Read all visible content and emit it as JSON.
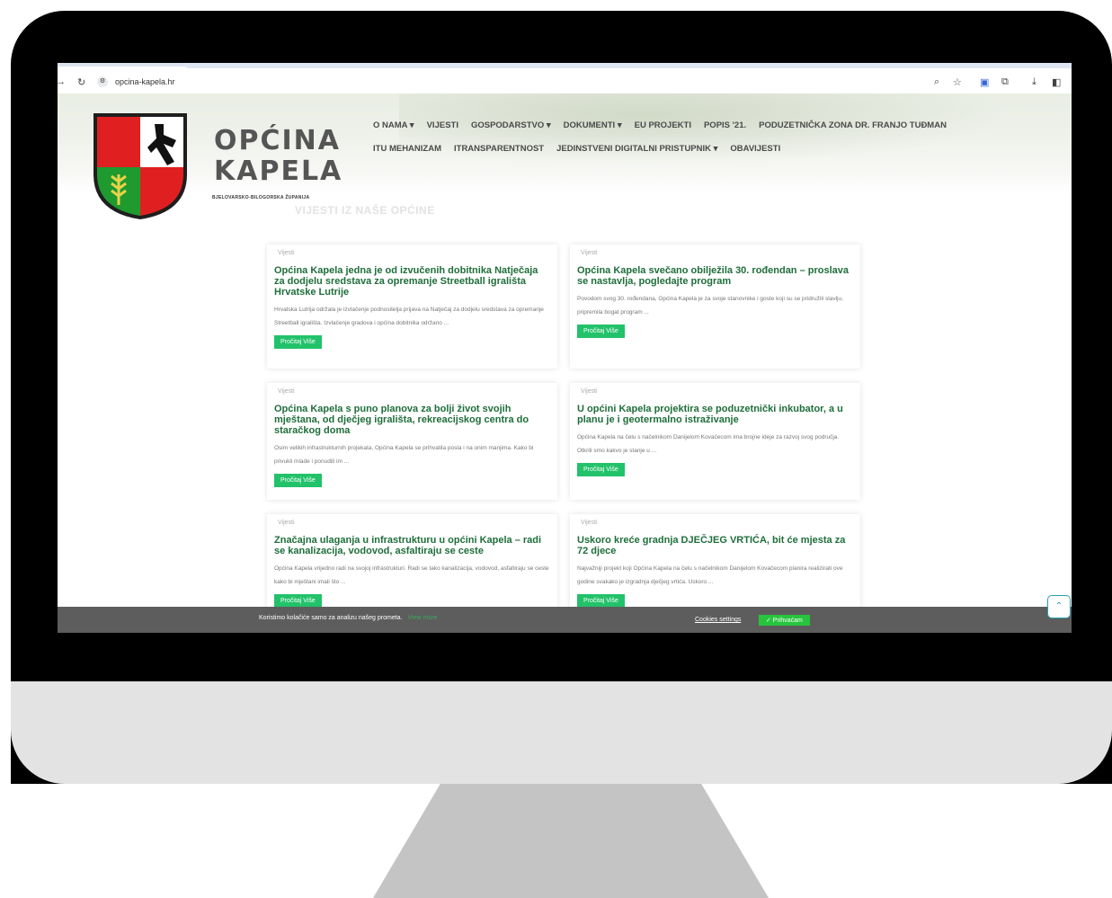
{
  "browser": {
    "url": "opcina-kapela.hr",
    "icons": {
      "back": "arrow-back-icon",
      "reload": "reload-icon",
      "tune": "site-info-icon",
      "zoom": "zoom-icon",
      "star": "bookmark-star-icon",
      "translate": "translate-icon",
      "extensions": "extensions-icon",
      "download": "download-icon",
      "sidepanel": "side-panel-icon"
    }
  },
  "logo": {
    "line1": "OPĆINA",
    "line2": "KAPELA",
    "subtitle": "BJELOVARSKO-BILOGORSKA ŽUPANIJA"
  },
  "menu": {
    "row1": [
      "O NAMA ▾",
      "VIJESTI",
      "GOSPODARSTVO ▾",
      "DOKUMENTI ▾",
      "EU PROJEKTI",
      "POPIS '21.",
      "PODUZETNIČKA ZONA DR. FRANJO TUĐMAN"
    ],
    "row2": [
      "ITU MEHANIZAM",
      "ITRANSPARENTNOST",
      "JEDINSTVENI DIGITALNI PRISTUPNIK ▾",
      "OBAVIJESTI"
    ]
  },
  "section_title": "VIJESTI IZ NAŠE OPĆINE",
  "cards": [
    {
      "category": "Vijesti",
      "title": "Općina Kapela jedna je od izvučenih dobitnika Natječaja za dodjelu sredstava za opremanje Streetball igrališta Hrvatske Lutrije",
      "excerpt": "Hrvatska Lutrija održala je izvlačenje podnositelja prijava na Natječaj za dodjelu sredstava za opremanje Streetball igrališta. Izvlačenje gradova i općina dobitnika održano ...",
      "button": "Pročitaj Više"
    },
    {
      "category": "Vijesti",
      "title": "Općina Kapela svečano obilježila 30. rođendan – proslava se nastavlja, pogledajte program",
      "excerpt": "Povodom svog 30. rođendana, Općina Kapela je za svoje stanovnike i goste koji su se pridružili slavlju, pripremila bogat program ...",
      "button": "Pročitaj Više"
    },
    {
      "category": "Vijesti",
      "title": "Općina Kapela s puno planova za bolji život svojih mještana, od dječjeg igrališta, rekreacijskog centra do staračkog doma",
      "excerpt": "Osim velikih infrastrukturnih projekata, Općina Kapela se prihvatila posla i na onim manjima. Kako bi privukli mlade i ponudili im ...",
      "button": "Pročitaj Više"
    },
    {
      "category": "Vijesti",
      "title": "U općini Kapela projektira se poduzetnički inkubator, a u planu je i geotermalno istraživanje",
      "excerpt": "Općina Kapela na čelu s načelnikom Danijelom Kovačecom ima brojne ideje za razvoj svog područja. Otkrili smo kakvo je stanje u ...",
      "button": "Pročitaj Više"
    },
    {
      "category": "Vijesti",
      "title": "Značajna ulaganja u infrastrukturu u općini Kapela – radi se kanalizacija, vodovod, asfaltiraju se ceste",
      "excerpt": "Općina Kapela vrijedno radi na svojoj infrastrukturi. Radi se tako kanalizacija, vodovod, asfaltiraju se ceste kako bi mještani imali što ...",
      "button": "Pročitaj Više"
    },
    {
      "category": "Vijesti",
      "title": "Uskoro kreće gradnja DJEČJEG VRTIĆA, bit će mjesta za 72 djece",
      "excerpt": "Najvažniji projekt koji Općina Kapela na čelu s načelnikom Danijelom Kovačecom planira realizirati ove godine svakako je izgradnja dječjeg vrtića. Uskoro ...",
      "button": "Pročitaj Više"
    }
  ],
  "cookie": {
    "message": "Koristimo kolačiće samo za analizu našeg prometa.",
    "more": "View more",
    "settings": "Cookies settings",
    "accept": "✓ Prihvaćam"
  },
  "colors": {
    "green_title": "#1e6e3a",
    "green_button": "#22c26a",
    "cookie_bg": "#5d5d5d",
    "shield_red": "#e02020",
    "shield_green": "#1e9a2e"
  }
}
